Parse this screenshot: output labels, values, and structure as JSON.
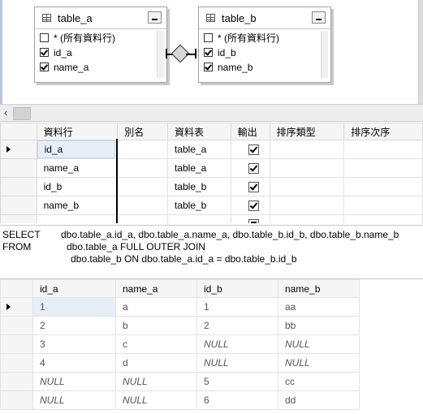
{
  "diagram": {
    "table_a": {
      "name": "table_a",
      "columns": [
        {
          "label": "* (所有資料行)",
          "checked": false
        },
        {
          "label": "id_a",
          "checked": true
        },
        {
          "label": "name_a",
          "checked": true
        }
      ]
    },
    "table_b": {
      "name": "table_b",
      "columns": [
        {
          "label": "* (所有資料行)",
          "checked": false
        },
        {
          "label": "id_b",
          "checked": true
        },
        {
          "label": "name_b",
          "checked": true
        }
      ]
    },
    "icons": {
      "table": "table-icon",
      "minimize": "minimize-icon",
      "join": "full-outer-join-icon"
    }
  },
  "scroll": {
    "left_arrow": "‹"
  },
  "criteria": {
    "headers": [
      "資料行",
      "別名",
      "資料表",
      "輸出",
      "排序類型",
      "排序次序"
    ],
    "rows": [
      {
        "column": "id_a",
        "alias": "",
        "table": "table_a",
        "output": true
      },
      {
        "column": "name_a",
        "alias": "",
        "table": "table_a",
        "output": true
      },
      {
        "column": "id_b",
        "alias": "",
        "table": "table_b",
        "output": true
      },
      {
        "column": "name_b",
        "alias": "",
        "table": "table_b",
        "output": true
      }
    ]
  },
  "sql": {
    "line1_kw": "SELECT",
    "line1": "dbo.table_a.id_a, dbo.table_a.name_a, dbo.table_b.id_b, dbo.table_b.name_b",
    "line2_kw": "FROM",
    "line2": "dbo.table_a FULL OUTER JOIN",
    "line3": "dbo.table_b ON dbo.table_a.id_a = dbo.table_b.id_b"
  },
  "results": {
    "headers": [
      "id_a",
      "name_a",
      "id_b",
      "name_b"
    ],
    "rows": [
      [
        "1",
        "a",
        "1",
        "aa"
      ],
      [
        "2",
        "b",
        "2",
        "bb"
      ],
      [
        "3",
        "c",
        "NULL",
        "NULL"
      ],
      [
        "4",
        "d",
        "NULL",
        "NULL"
      ],
      [
        "NULL",
        "NULL",
        "5",
        "cc"
      ],
      [
        "NULL",
        "NULL",
        "6",
        "dd"
      ]
    ]
  }
}
